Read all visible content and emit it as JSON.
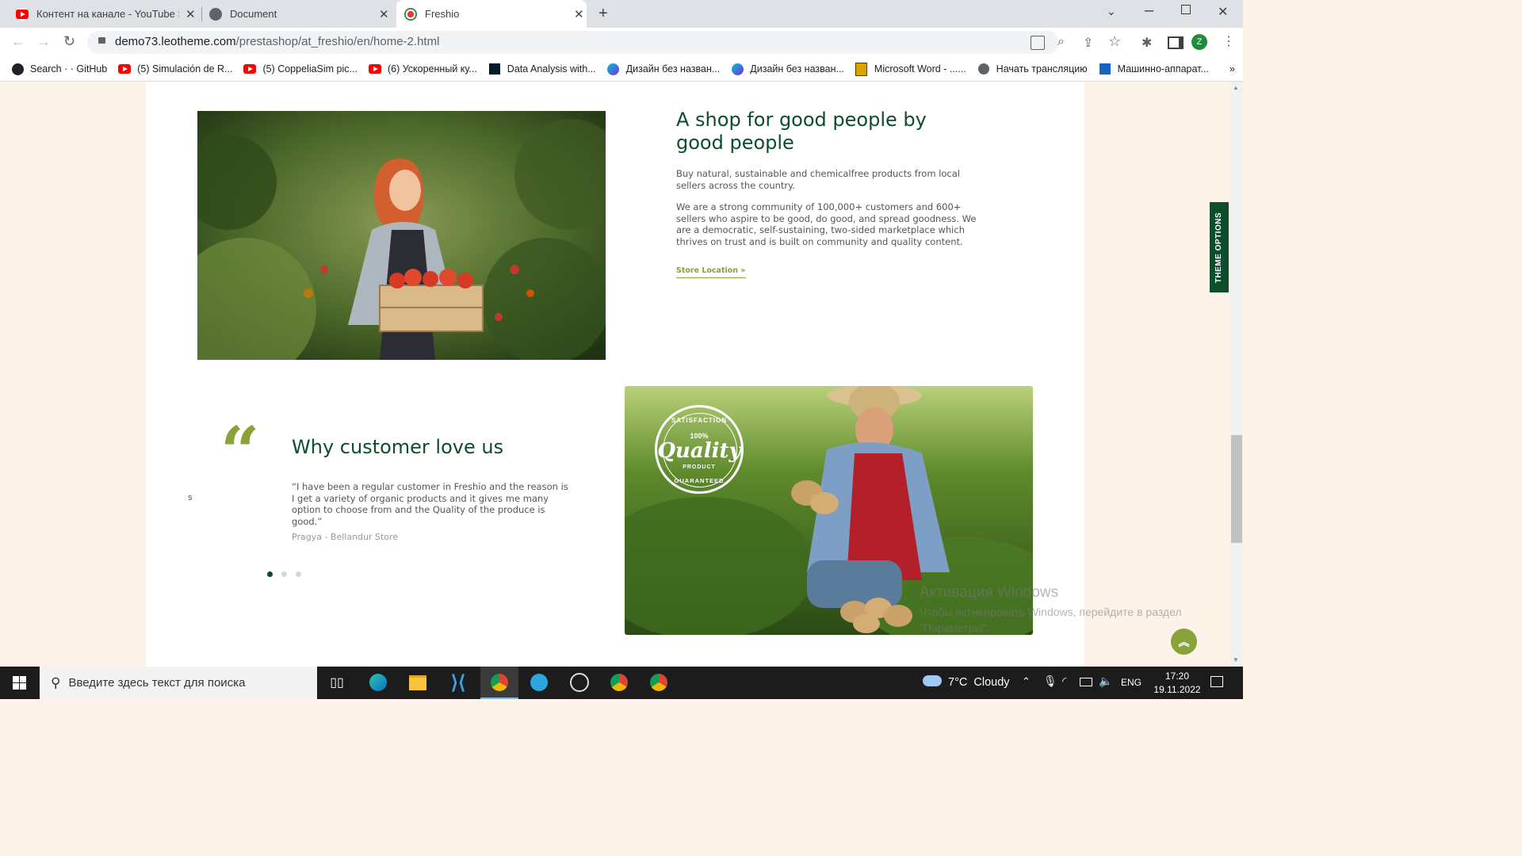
{
  "browser": {
    "tabs": [
      {
        "title": "Контент на канале - YouTube St",
        "icon": "youtube-icon",
        "active": false
      },
      {
        "title": "Document",
        "icon": "globe-icon",
        "active": false
      },
      {
        "title": "Freshio",
        "icon": "freshio-icon",
        "active": true
      }
    ],
    "url_host": "demo73.leotheme.com",
    "url_path": "/prestashop/at_freshio/en/home-2.html",
    "profile_initial": "Z",
    "bookmarks": [
      {
        "label": "Search · · GitHub",
        "icon": "github-icon"
      },
      {
        "label": "(5) Simulación de R...",
        "icon": "youtube-icon"
      },
      {
        "label": "(5) CoppeliaSim pic...",
        "icon": "youtube-icon"
      },
      {
        "label": "(6) Ускоренный ку...",
        "icon": "youtube-icon"
      },
      {
        "label": "Data Analysis with...",
        "icon": "datacamp-icon"
      },
      {
        "label": "Дизайн без назван...",
        "icon": "canva-icon"
      },
      {
        "label": "Дизайн без назван...",
        "icon": "canva-icon"
      },
      {
        "label": "Microsoft Word - ......",
        "icon": "word-pdf-icon"
      },
      {
        "label": "Начать трансляцию",
        "icon": "globe-icon"
      },
      {
        "label": "Машинно-аппарат...",
        "icon": "m-icon"
      }
    ],
    "more": "»"
  },
  "about": {
    "heading_line1": "A shop for good people by",
    "heading_line2": "good people",
    "para1": "Buy natural, sustainable and chemicalfree products from local sellers across the country.",
    "para2": "We are a strong community of 100,000+ customers and 600+ sellers who aspire to be good, do good, and spread goodness. We are a democratic, self-sustaining, two-sided marketplace which thrives on trust and is built on community and quality content.",
    "link": "Store Location »"
  },
  "testimonial": {
    "quote_mark": "“",
    "heading": "Why customer love us",
    "text": "“I have been a regular customer in Freshio and the reason is I get a variety of organic products and it gives me many option to choose from and the Quality of the produce is good.”",
    "author": "Pragya - Bellandur Store",
    "stray": "s",
    "slides": 3,
    "active_slide": 1
  },
  "badge": {
    "top": "SATISFACTION",
    "percent": "100%",
    "word": "Quality",
    "sub": "PRODUCT",
    "bottom": "GUARANTEED"
  },
  "theme_options": "THEME OPTIONS",
  "watermark": {
    "line1": "Активация Windows",
    "line2": "Чтобы активировать Windows, перейдите в раздел",
    "line3": "\"Параметры\"."
  },
  "taskbar": {
    "search_placeholder": "Введите здесь текст для поиска",
    "weather": "7°C  Cloudy",
    "lang": "ENG",
    "time": "17:20",
    "date": "19.11.2022"
  },
  "colors": {
    "brand_green": "#0b4d2c",
    "accent_olive": "#8aa23a",
    "page_bg": "#fdf3e9"
  }
}
